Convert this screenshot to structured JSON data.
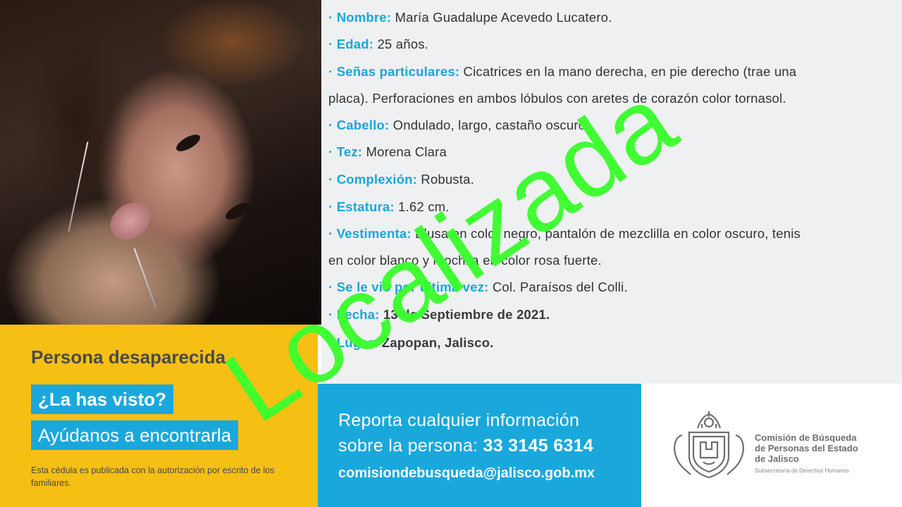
{
  "fields": [
    {
      "label": "· Nombre:",
      "value": "María Guadalupe Acevedo Lucatero."
    },
    {
      "label": "· Edad:",
      "value": "25 años."
    },
    {
      "label": "· Señas particulares:",
      "value": "Cicatrices en la mano derecha, en pie derecho (trae una",
      "value2": "placa). Perforaciones en ambos lóbulos con aretes de corazón color tornasol."
    },
    {
      "label": "· Cabello:",
      "value": "Ondulado, largo, castaño oscuro."
    },
    {
      "label": "· Tez:",
      "value": "Morena Clara"
    },
    {
      "label": "· Complexión:",
      "value": "Robusta."
    },
    {
      "label": "· Estatura:",
      "value": "1.62 cm."
    },
    {
      "label": "· Vestimenta:",
      "value": "Blusa en color negro, pantalón de mezclilla en color oscuro, tenis",
      "value2": "en color blanco y mochila en color rosa fuerte."
    },
    {
      "label": "· Se le vio por última vez:",
      "value": "Col. Paraísos del Colli."
    },
    {
      "label": "· Fecha:",
      "value": "13 de Septiembre de 2021."
    },
    {
      "label": "· Lugar:",
      "value": "Zapopan, Jalisco."
    }
  ],
  "yellow": {
    "title": "Persona desaparecida",
    "question": "¿La has visto?",
    "help": "Ayúdanos a encontrarla",
    "note": "Esta cédula es publicada con la autorización por escrito de los familiares."
  },
  "blue": {
    "line1": "Reporta cualquier información",
    "line2_text": "sobre la persona:",
    "phone": "33 3145 6314",
    "email": "comisiondebusqueda@jalisco.gob.mx"
  },
  "org": {
    "line1": "Comisión de Búsqueda",
    "line2": "de Personas del Estado",
    "line3": "de Jalisco",
    "sub": "Subsecretaría de Derechos Humanos"
  },
  "stamp": "Localizada",
  "colors": {
    "accent_blue": "#1aa8dc",
    "accent_yellow": "#f6bf14",
    "stamp_green": "#3cff2e",
    "panel_gray": "#eff0f2"
  }
}
